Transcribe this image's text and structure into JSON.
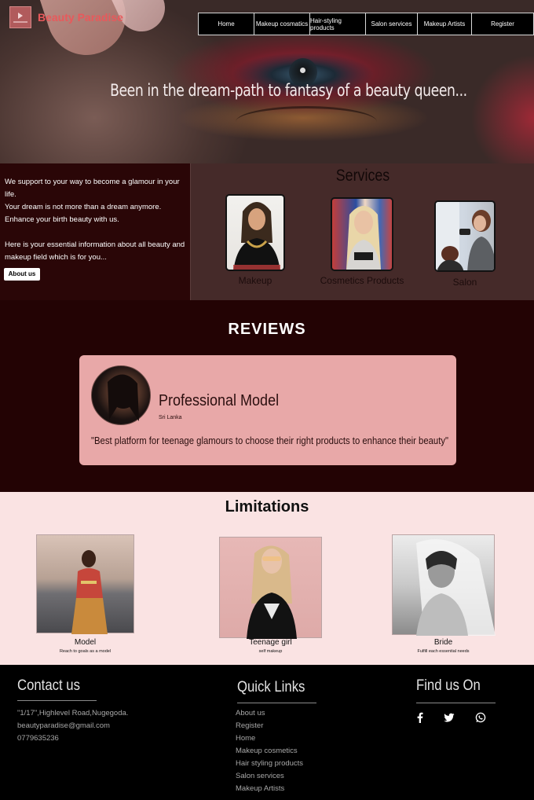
{
  "brand": {
    "name": "Beauty Paradise"
  },
  "nav": [
    "Home",
    "Makeup cosmatics",
    "Hair-styling products",
    "Salon services",
    "Makeup Artists",
    "Register"
  ],
  "hero": {
    "tagline": "Been in the dream-path to fantasy of a beauty queen..."
  },
  "about": {
    "line1": "We support to your way to become a glamour in your life.",
    "line2": "Your dream is not more than a dream anymore.",
    "line3": "Enhance your birth beauty with us.",
    "line4": "Here is your essential information about all beauty and",
    "line5": "makeup field which is for you...",
    "button": "About us"
  },
  "services": {
    "title": "Services",
    "items": [
      "Makeup",
      "Cosmetics  Products",
      "Salon"
    ]
  },
  "reviews": {
    "title": "REVIEWS",
    "name": "Professional Model",
    "country": "Sri Lanka",
    "quote": "\"Best platform for teenage glamours to choose their right products to enhance their beauty\""
  },
  "limitations": {
    "title": "Limitations",
    "items": [
      {
        "name": "Model",
        "sub": "Reach to goals as a model"
      },
      {
        "name": "Teenage girl",
        "sub": "self makeup"
      },
      {
        "name": "Bride",
        "sub": "Fulfill each essential needs"
      }
    ]
  },
  "footer": {
    "contact": {
      "title": "Contact us",
      "address": "\"1/17\",Highlevel Road,Nugegoda.",
      "email": "beautyparadise@gmail.com",
      "phone": "0779635236"
    },
    "quick": {
      "title": "Quick Links",
      "links": [
        "About us",
        "Register",
        "Home",
        "Makeup cosmetics",
        "Hair styling products",
        "Salon services",
        "Makeup Artists"
      ]
    },
    "find": {
      "title": "Find us On",
      "icons": [
        "facebook-icon",
        "twitter-icon",
        "whatsapp-icon"
      ]
    }
  },
  "colors": {
    "accent": "#e8595b",
    "dark_maroon": "#230304",
    "card_pink": "#e8a8a8",
    "limits_bg": "#fae3e3"
  }
}
